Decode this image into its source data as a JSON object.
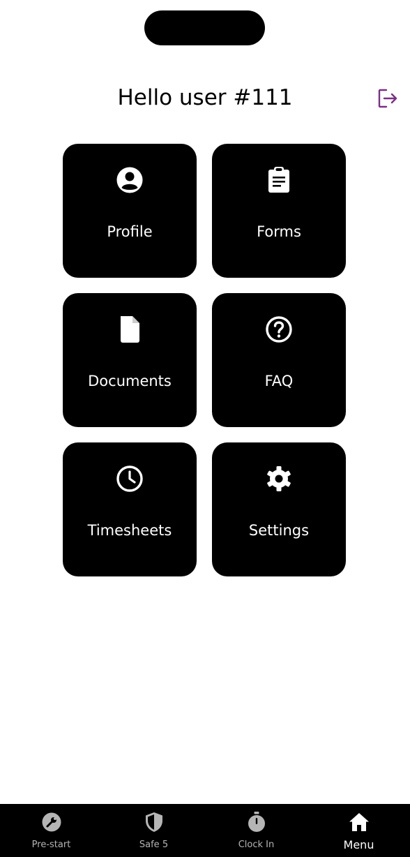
{
  "header": {
    "title": "Hello user #111",
    "logout_icon": "logout-icon",
    "logout_color": "#7b2f86"
  },
  "menu": {
    "tiles": [
      {
        "label": "Profile",
        "icon": "account-circle-icon"
      },
      {
        "label": "Forms",
        "icon": "clipboard-icon"
      },
      {
        "label": "Documents",
        "icon": "document-icon"
      },
      {
        "label": "FAQ",
        "icon": "help-circle-icon"
      },
      {
        "label": "Timesheets",
        "icon": "clock-icon"
      },
      {
        "label": "Settings",
        "icon": "gear-icon"
      }
    ]
  },
  "bottom_nav": {
    "items": [
      {
        "label": "Pre-start",
        "icon": "wrench-icon"
      },
      {
        "label": "Safe 5",
        "icon": "shield-icon"
      },
      {
        "label": "Clock In",
        "icon": "stopwatch-icon"
      },
      {
        "label": "Menu",
        "icon": "home-icon",
        "active": true
      }
    ]
  },
  "colors": {
    "background": "#ffffff",
    "tile": "#000000",
    "nav_bar": "#000000",
    "nav_inactive": "#b5b5b5",
    "nav_active": "#ffffff"
  }
}
